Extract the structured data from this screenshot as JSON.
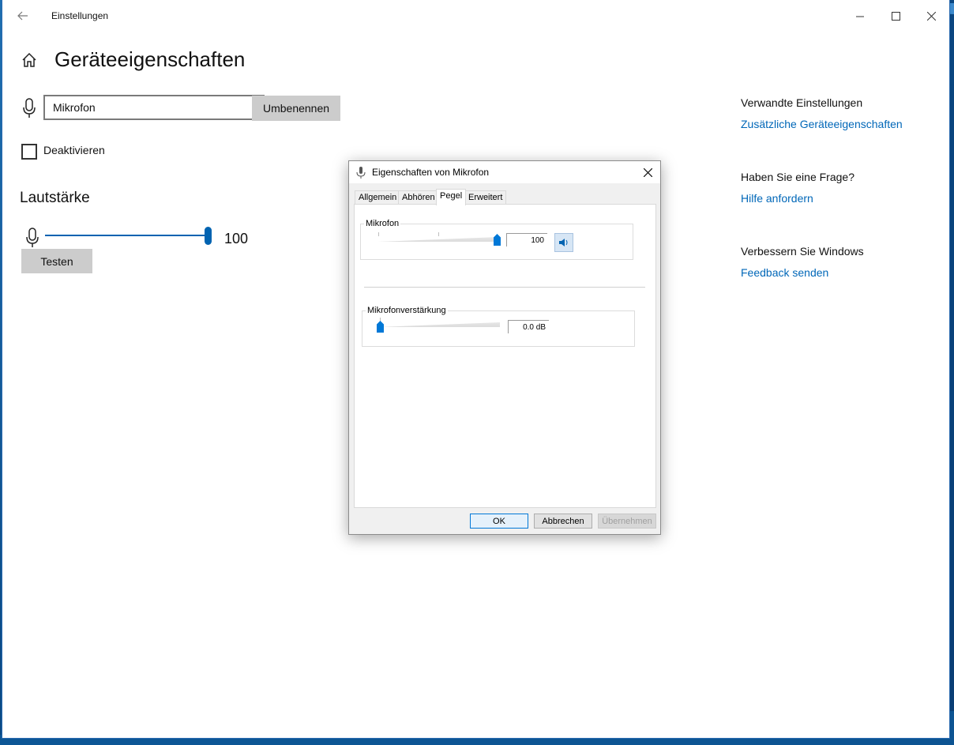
{
  "window": {
    "title": "Einstellungen",
    "controls": {
      "minimize": "minimize-icon",
      "maximize": "maximize-icon",
      "close": "close-icon"
    }
  },
  "page": {
    "title": "Geräteeigenschaften"
  },
  "device": {
    "name_value": "Mikrofon",
    "rename_label": "Umbenennen",
    "disable_label": "Deaktivieren",
    "disable_checked": false
  },
  "volume": {
    "section_title": "Lautstärke",
    "value_text": "100",
    "level": 100,
    "test_label": "Testen"
  },
  "related": {
    "heading": "Verwandte Einstellungen",
    "link": "Zusätzliche Geräteeigenschaften",
    "question_heading": "Haben Sie eine Frage?",
    "help_link": "Hilfe anfordern",
    "improve_heading": "Verbessern Sie Windows",
    "feedback_link": "Feedback senden"
  },
  "dialog": {
    "title": "Eigenschaften von Mikrofon",
    "tabs": [
      "Allgemein",
      "Abhören",
      "Pegel",
      "Erweitert"
    ],
    "active_tab": "Pegel",
    "mic_group_label": "Mikrofon",
    "mic_level_text": "100",
    "mic_level": 100,
    "boost_group_label": "Mikrofonverstärkung",
    "boost_value_text": "0.0 dB",
    "boost_level": 0,
    "ok_label": "OK",
    "cancel_label": "Abbrechen",
    "apply_label": "Übernehmen"
  },
  "colors": {
    "accent": "#0063b1",
    "link": "#0067b8",
    "button_gray": "#cccccc"
  }
}
